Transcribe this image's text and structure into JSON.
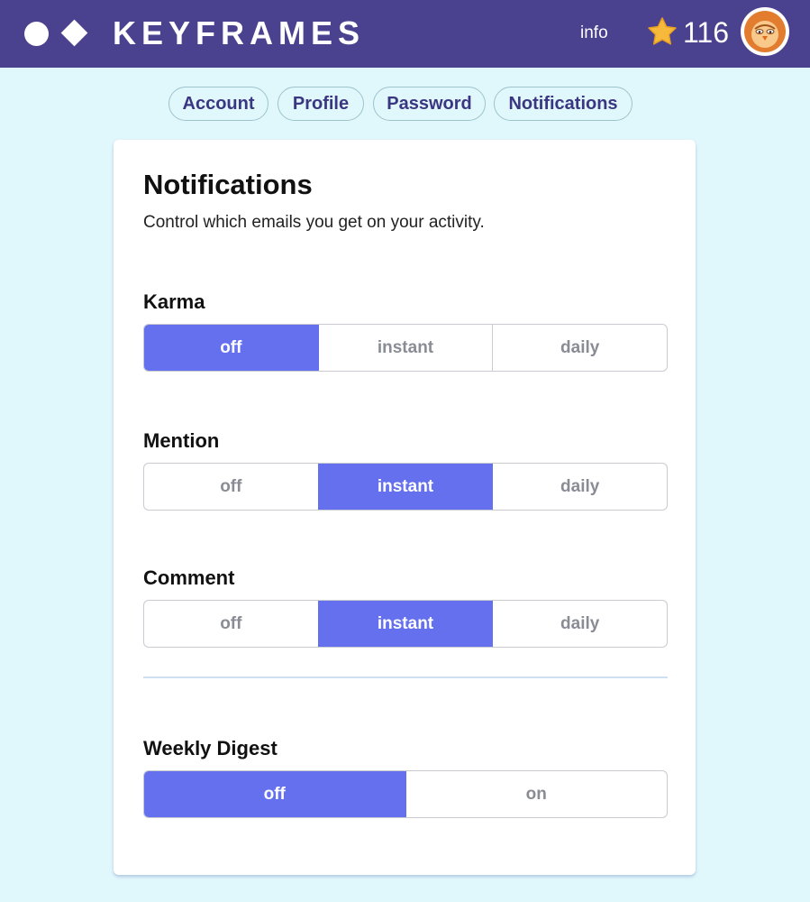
{
  "header": {
    "brand": "KEYFRAMES",
    "info_link": "info",
    "karma_count": "116",
    "icons": [
      "logo-circle",
      "logo-diamond",
      "star-icon",
      "avatar"
    ],
    "colors": {
      "bar": "#4a418f",
      "star": "#f6b93b",
      "avatar_ring": "#e27d2f"
    }
  },
  "tabs": [
    {
      "label": "Account"
    },
    {
      "label": "Profile"
    },
    {
      "label": "Password"
    },
    {
      "label": "Notifications"
    }
  ],
  "page": {
    "title": "Notifications",
    "description": "Control which emails you get on your activity."
  },
  "settings": [
    {
      "label": "Karma",
      "options": [
        "off",
        "instant",
        "daily"
      ],
      "selected": "off"
    },
    {
      "label": "Mention",
      "options": [
        "off",
        "instant",
        "daily"
      ],
      "selected": "instant"
    },
    {
      "label": "Comment",
      "options": [
        "off",
        "instant",
        "daily"
      ],
      "selected": "instant"
    },
    {
      "label": "Weekly Digest",
      "options": [
        "off",
        "on"
      ],
      "selected": "off"
    }
  ],
  "accent_color": "#6470ee"
}
